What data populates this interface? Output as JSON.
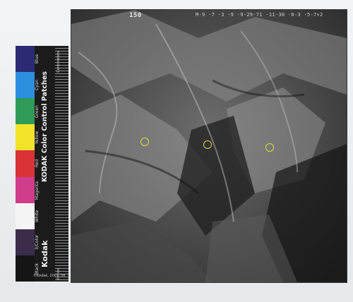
{
  "photo": {
    "frame_number": "150",
    "caption": "M·9  ·7  ·3   ·9  ·9-29-71  ·11·30  ·0-3  ·5-7+2",
    "marker_color": "#d7e13a",
    "tone": "grayscale aerial photograph of a mountainous, heavily dissected terrain"
  },
  "color_strip": {
    "title": "KODAK Color Control Patches",
    "brand": "Kodak",
    "brand_mark": "©Kodak, 2007 TM",
    "ruler_top_label": "Centimeters",
    "ruler_bottom_label": "Inches",
    "patches": [
      {
        "label": "Blue",
        "color": "#2b2b74"
      },
      {
        "label": "Cyan",
        "color": "#2b8fe0"
      },
      {
        "label": "Green",
        "color": "#2e9b58"
      },
      {
        "label": "Yellow",
        "color": "#f2e32a"
      },
      {
        "label": "Red",
        "color": "#d93237"
      },
      {
        "label": "Magenta",
        "color": "#cf3d8b"
      },
      {
        "label": "White",
        "color": "#f4f4f4"
      },
      {
        "label": "3/Color",
        "color": "#3a2c4a"
      },
      {
        "label": "Black",
        "color": "#151515"
      }
    ]
  }
}
